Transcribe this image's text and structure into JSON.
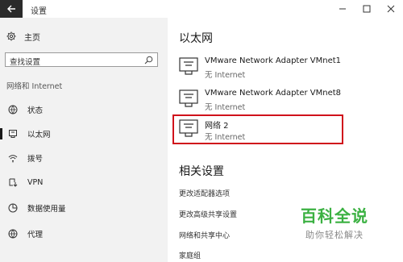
{
  "window": {
    "title": "设置"
  },
  "sidebar": {
    "home_label": "主页",
    "search_placeholder": "查找设置",
    "section_title": "网络和 Internet",
    "items": [
      {
        "label": "状态",
        "icon": "status-icon"
      },
      {
        "label": "以太网",
        "icon": "ethernet-icon",
        "selected": true
      },
      {
        "label": "拨号",
        "icon": "dialup-icon"
      },
      {
        "label": "VPN",
        "icon": "vpn-icon"
      },
      {
        "label": "数据使用量",
        "icon": "data-usage-icon"
      },
      {
        "label": "代理",
        "icon": "proxy-icon"
      }
    ]
  },
  "main": {
    "title": "以太网",
    "adapters": [
      {
        "name": "VMware Network Adapter VMnet1",
        "status": "无 Internet"
      },
      {
        "name": "VMware Network Adapter VMnet8",
        "status": "无 Internet"
      },
      {
        "name": "网络  2",
        "status": "无 Internet",
        "highlighted": true
      }
    ],
    "related_title": "相关设置",
    "related_links": [
      "更改适配器选项",
      "更改高级共享设置",
      "网络和共享中心",
      "家庭组"
    ]
  },
  "watermark": {
    "brand": "百科全说",
    "slogan": "助你轻松解决"
  },
  "colors": {
    "highlight": "#d0121b",
    "watermark": "#3bb142",
    "sidebar_bg": "#f2f2f2"
  }
}
